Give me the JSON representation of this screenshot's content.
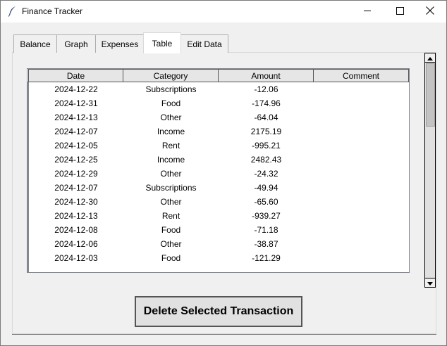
{
  "window": {
    "title": "Finance Tracker"
  },
  "tabs": [
    {
      "label": "Balance",
      "selected": false
    },
    {
      "label": "Graph",
      "selected": false
    },
    {
      "label": "Expenses",
      "selected": false
    },
    {
      "label": "Table",
      "selected": true
    },
    {
      "label": "Edit Data",
      "selected": false
    }
  ],
  "table": {
    "columns": [
      "Date",
      "Category",
      "Amount",
      "Comment"
    ],
    "rows": [
      [
        "2024-12-22",
        "Subscriptions",
        "-12.06",
        ""
      ],
      [
        "2024-12-31",
        "Food",
        "-174.96",
        ""
      ],
      [
        "2024-12-13",
        "Other",
        "-64.04",
        ""
      ],
      [
        "2024-12-07",
        "Income",
        "2175.19",
        ""
      ],
      [
        "2024-12-05",
        "Rent",
        "-995.21",
        ""
      ],
      [
        "2024-12-25",
        "Income",
        "2482.43",
        ""
      ],
      [
        "2024-12-29",
        "Other",
        "-24.32",
        ""
      ],
      [
        "2024-12-07",
        "Subscriptions",
        "-49.94",
        ""
      ],
      [
        "2024-12-30",
        "Other",
        "-65.60",
        ""
      ],
      [
        "2024-12-13",
        "Rent",
        "-939.27",
        ""
      ],
      [
        "2024-12-08",
        "Food",
        "-71.18",
        ""
      ],
      [
        "2024-12-06",
        "Other",
        "-38.87",
        ""
      ],
      [
        "2024-12-03",
        "Food",
        "-121.29",
        ""
      ]
    ]
  },
  "actions": {
    "delete_label": "Delete Selected Transaction"
  },
  "icons": {
    "app": "feather-icon",
    "minimize": "minimize-icon",
    "maximize": "maximize-icon",
    "close": "close-icon",
    "scroll_up": "arrow-up-icon",
    "scroll_down": "arrow-down-icon"
  }
}
